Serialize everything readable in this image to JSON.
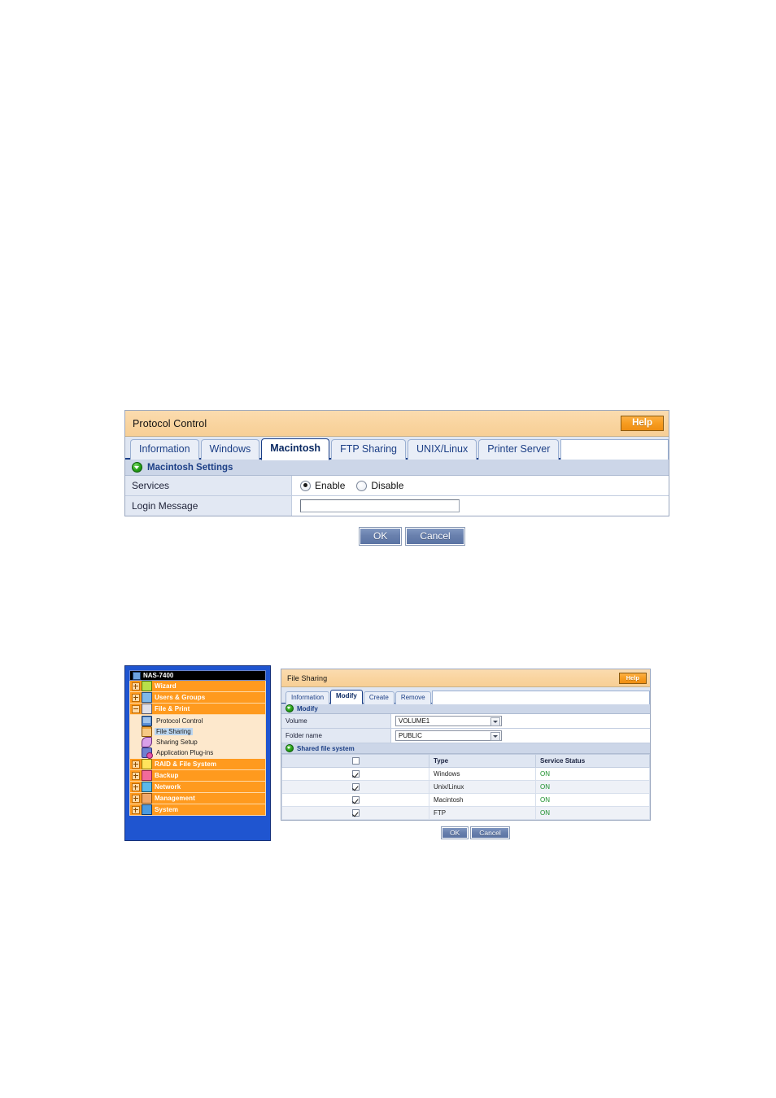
{
  "colors": {
    "header_orange": "#f9d49f",
    "help_orange": "#f79c20",
    "tab_blue": "#1a3e86",
    "section_bar": "#ccd6e8",
    "sidebar_blue": "#1f55d0",
    "nav_orange": "#ff9a1e",
    "status_green": "#1a8f2a"
  },
  "protocol_control": {
    "title": "Protocol Control",
    "help_label": "Help",
    "tabs": [
      {
        "label": "Information",
        "active": false
      },
      {
        "label": "Windows",
        "active": false
      },
      {
        "label": "Macintosh",
        "active": true
      },
      {
        "label": "FTP Sharing",
        "active": false
      },
      {
        "label": "UNIX/Linux",
        "active": false
      },
      {
        "label": "Printer Server",
        "active": false
      }
    ],
    "section_label": "Macintosh Settings",
    "rows": {
      "services_label": "Services",
      "radio_enable": "Enable",
      "radio_disable": "Disable",
      "radio_selected": "Enable",
      "login_message_label": "Login Message",
      "login_message_value": "",
      "login_message_placeholder": ""
    },
    "buttons": {
      "ok": "OK",
      "cancel": "Cancel"
    }
  },
  "sidebar": {
    "root_label": "NAS-7400",
    "items": [
      {
        "label": "Wizard",
        "icon": "wizard-icon",
        "expandable": true
      },
      {
        "label": "Users & Groups",
        "icon": "users-icon",
        "expandable": true
      },
      {
        "label": "File & Print",
        "icon": "print-icon",
        "expandable": true,
        "expanded": true
      }
    ],
    "sub_items": [
      {
        "label": "Protocol Control",
        "icon": "monitor-icon",
        "selected": false
      },
      {
        "label": "File Sharing",
        "icon": "folder-icon",
        "selected": true
      },
      {
        "label": "Sharing Setup",
        "icon": "share-icon",
        "selected": false
      },
      {
        "label": "Application Plug-ins",
        "icon": "plug-icon",
        "selected": false
      }
    ],
    "items_after": [
      {
        "label": "RAID & File System",
        "icon": "raid-icon",
        "expandable": true
      },
      {
        "label": "Backup",
        "icon": "backup-icon",
        "expandable": true
      },
      {
        "label": "Network",
        "icon": "network-icon",
        "expandable": true
      },
      {
        "label": "Management",
        "icon": "management-icon",
        "expandable": true
      },
      {
        "label": "System",
        "icon": "system-icon",
        "expandable": true
      }
    ]
  },
  "file_sharing": {
    "title": "File Sharing",
    "help_label": "Help",
    "tabs": [
      {
        "label": "Information",
        "active": false
      },
      {
        "label": "Modify",
        "active": true
      },
      {
        "label": "Create",
        "active": false
      },
      {
        "label": "Remove",
        "active": false
      }
    ],
    "section_label": "Modify",
    "volume_label": "Volume",
    "volume_value": "VOLUME1",
    "folder_label": "Folder name",
    "folder_value": "PUBLIC",
    "shared_section_label": "Shared file system",
    "table": {
      "headers": [
        "",
        "Type",
        "Service Status"
      ],
      "header_checkbox_checked": false,
      "rows": [
        {
          "checked": true,
          "type": "Windows",
          "status": "ON"
        },
        {
          "checked": true,
          "type": "Unix/Linux",
          "status": "ON"
        },
        {
          "checked": true,
          "type": "Macintosh",
          "status": "ON"
        },
        {
          "checked": true,
          "type": "FTP",
          "status": "ON"
        }
      ]
    },
    "buttons": {
      "ok": "OK",
      "cancel": "Cancel"
    }
  }
}
